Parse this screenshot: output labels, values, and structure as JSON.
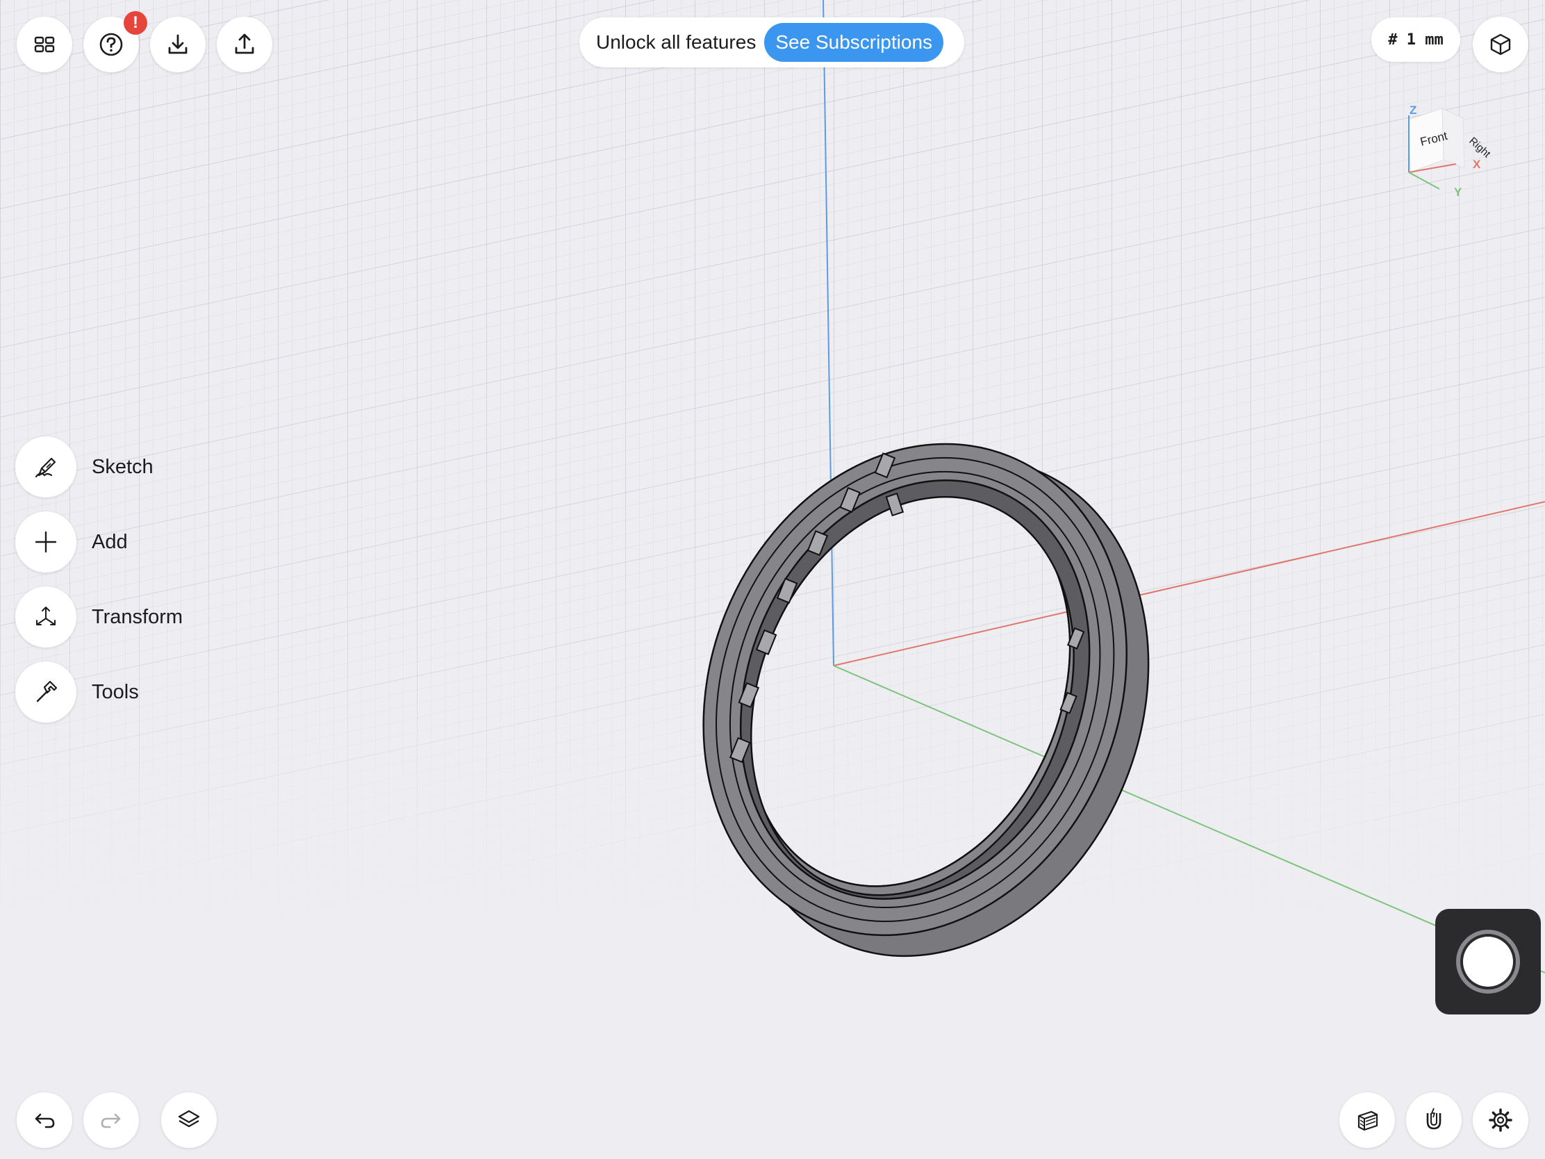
{
  "toolbar": {
    "menu_icon": "grid-menu-icon",
    "help_icon": "question-circle-icon",
    "help_badge": "!",
    "import_icon": "download-icon",
    "export_icon": "share-icon"
  },
  "promo": {
    "text": "Unlock all features",
    "button_label": "See Subscriptions",
    "button_color": "#3a96ee"
  },
  "grid": {
    "label": "# 1 mm"
  },
  "view_toggle": {
    "icon": "perspective-cube-icon"
  },
  "view_cube": {
    "front_label": "Front",
    "right_label": "Right",
    "axis_z": "Z",
    "axis_x": "X",
    "axis_y": "Y"
  },
  "tools_menu": [
    {
      "label": "Sketch",
      "icon": "pencil-icon"
    },
    {
      "label": "Add",
      "icon": "plus-icon"
    },
    {
      "label": "Transform",
      "icon": "transform-arrows-icon"
    },
    {
      "label": "Tools",
      "icon": "hammer-icon"
    }
  ],
  "bottom_bar": {
    "undo_icon": "undo-icon",
    "redo_icon": "redo-icon",
    "layers_icon": "layers-icon",
    "section_icon": "section-view-icon",
    "snap_icon": "magnet-icon",
    "settings_icon": "gear-icon"
  },
  "colors": {
    "axis_x": "#e0766c",
    "axis_y": "#7cc47c",
    "axis_z": "#5b9be0",
    "model_body": "#838387",
    "background": "#eeeef2"
  }
}
